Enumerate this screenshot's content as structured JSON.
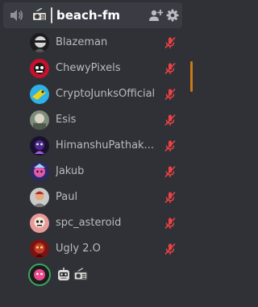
{
  "channel": {
    "name": "beach-fm",
    "icons": [
      "speaker-icon",
      "radio-emoji",
      "invite-icon",
      "gear-icon"
    ]
  },
  "members": [
    {
      "name": "Blazeman",
      "muted": true
    },
    {
      "name": "ChewyPixels",
      "muted": true
    },
    {
      "name": "CryptoJunksOfficial",
      "muted": true
    },
    {
      "name": "Esis",
      "muted": true
    },
    {
      "name": "HimanshuPathak...",
      "muted": true
    },
    {
      "name": "Jakub",
      "muted": true
    },
    {
      "name": "Paul",
      "muted": true
    },
    {
      "name": "spc_asteroid",
      "muted": true
    },
    {
      "name": "Ugly 2.O",
      "muted": true
    }
  ],
  "speaking_member": {
    "status_emojis": [
      "robot-emoji",
      "radio-emoji"
    ]
  },
  "colors": {
    "background": "#2f3136",
    "channel_row": "#393c43",
    "muted_red": "#ed4245",
    "speaking_green": "#3ba55d",
    "text_muted": "#b9bbbe",
    "scroll_accent": "#c97a16"
  }
}
